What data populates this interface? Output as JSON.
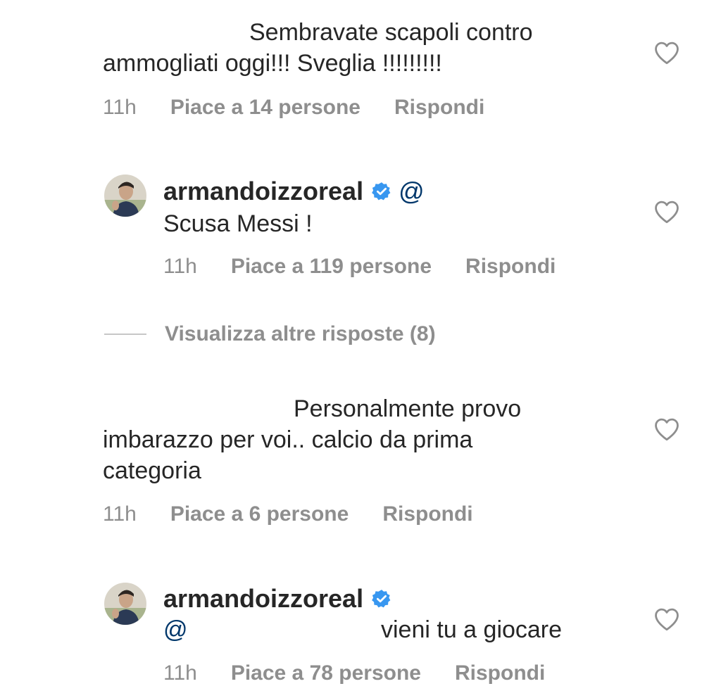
{
  "comments": [
    {
      "text_line1": "Sembravate scapoli contro",
      "text_line2": "ammogliati oggi!!! Sveglia !!!!!!!!!",
      "time": "11h",
      "likes": "Piace a 14 persone",
      "reply": "Rispondi",
      "liked": false
    },
    {
      "username": "armandoizzoreal",
      "verified": true,
      "mention": "@",
      "text": "Scusa Messi !",
      "time": "11h",
      "likes": "Piace a 119 persone",
      "reply": "Rispondi",
      "liked": false
    },
    {
      "text_line1": "Personalmente provo",
      "text_line2": "imbarazzo per voi.. calcio da prima",
      "text_line3": "categoria",
      "time": "11h",
      "likes": "Piace a 6 persone",
      "reply": "Rispondi",
      "liked": false
    },
    {
      "username": "armandoizzoreal",
      "verified": true,
      "mention": "@",
      "text": "vieni tu a giocare",
      "time": "11h",
      "likes": "Piace a 78 persone",
      "reply": "Rispondi",
      "liked": false
    }
  ],
  "view_more_replies": "Visualizza altre risposte (8)",
  "colors": {
    "text": "#262626",
    "meta": "#8e8e8e",
    "verified": "#3897f0",
    "mention": "#00376b"
  },
  "icons": {
    "like": "heart-outline-icon",
    "verified": "verified-badge-icon"
  }
}
